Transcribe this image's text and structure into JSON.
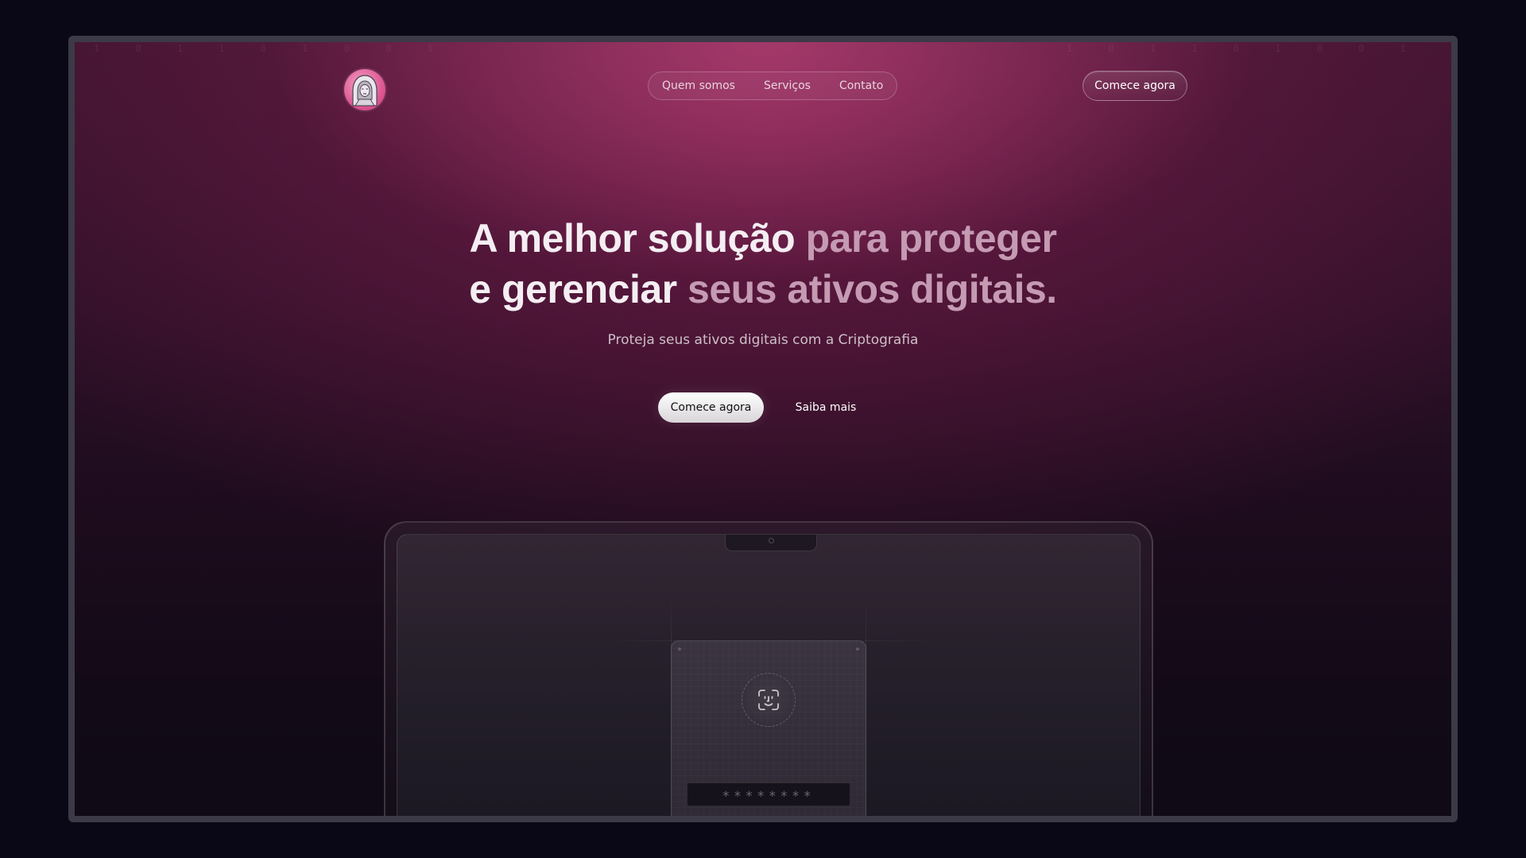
{
  "nav": {
    "items": [
      {
        "label": "Quem somos"
      },
      {
        "label": "Serviços"
      },
      {
        "label": "Contato"
      }
    ],
    "cta_label": "Comece agora"
  },
  "logo": {
    "icon": "hooded-figure-avatar"
  },
  "hero": {
    "headline_line1_bright": "A melhor solução",
    "headline_line1_dim": "para proteger",
    "headline_line2_bright": "e gerenciar",
    "headline_line2_dim": "seus ativos digitais.",
    "subtitle": "Proteja seus ativos digitais com a Criptografia",
    "primary_button": "Comece agora",
    "secondary_button": "Saiba mais"
  },
  "device": {
    "password_mask": "********",
    "faceid_icon": "face-id-icon"
  },
  "background": {
    "binary_pattern": "1 0 1 1 0 1 0 0 1 1 0 1 0 1 1 0 0 1 0 1 1 0 1 0 0 1 1 1 0 1 0 0 1 0 1 1 0 1 1 0 0 1 0 1 0 1 1 0 1 0 0 1"
  },
  "colors": {
    "accent_pink": "#d94f8d",
    "bg_dark": "#0a0817",
    "headline_bright": "#f4eef2",
    "headline_dim": "#c59ab3"
  }
}
